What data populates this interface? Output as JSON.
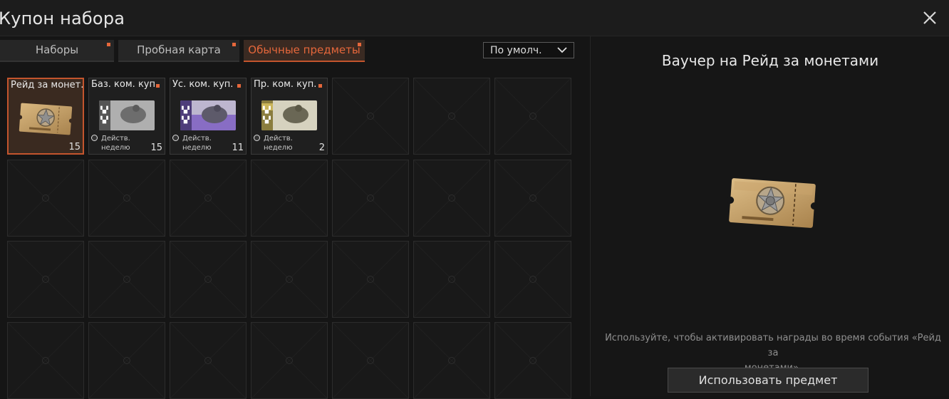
{
  "window": {
    "title": "Купон набора"
  },
  "tabs": [
    {
      "label": "Наборы",
      "active": false,
      "has_dot": true
    },
    {
      "label": "Пробная карта",
      "active": false,
      "has_dot": true
    },
    {
      "label": "Обычные предметы",
      "active": true,
      "has_dot": true
    }
  ],
  "sort": {
    "selected": "По умолч."
  },
  "items": [
    {
      "name": "Рейд за монет.",
      "qty": "15",
      "selected": true,
      "icon": "coin-raid-voucher-icon",
      "has_dot": false
    },
    {
      "name": "Баз. ком. куп.",
      "qty": "15",
      "selected": false,
      "icon": "basic-team-coupon-icon",
      "has_dot": true,
      "valid_line1": "Действ.",
      "valid_line2": "неделю",
      "accent": "#9a9a9a"
    },
    {
      "name": "Ус. ком. куп.",
      "qty": "11",
      "selected": false,
      "icon": "advanced-team-coupon-icon",
      "has_dot": true,
      "valid_line1": "Действ.",
      "valid_line2": "неделю",
      "accent": "#7a5bc0"
    },
    {
      "name": "Пр. ком. куп.",
      "qty": "2",
      "selected": false,
      "icon": "premium-team-coupon-icon",
      "has_dot": true,
      "valid_line1": "Действ.",
      "valid_line2": "неделю",
      "accent": "#c9b45a"
    }
  ],
  "detail": {
    "title": "Ваучер на Рейд за монетами",
    "icon": "coin-raid-voucher-icon",
    "description_line1": "Используйте, чтобы активировать награды во время события «Рейд за",
    "description_line2": "монетами».",
    "use_button": "Использовать предмет"
  },
  "colors": {
    "accent": "#e5673b",
    "selected_border": "#c4552d",
    "background": "#151515"
  }
}
